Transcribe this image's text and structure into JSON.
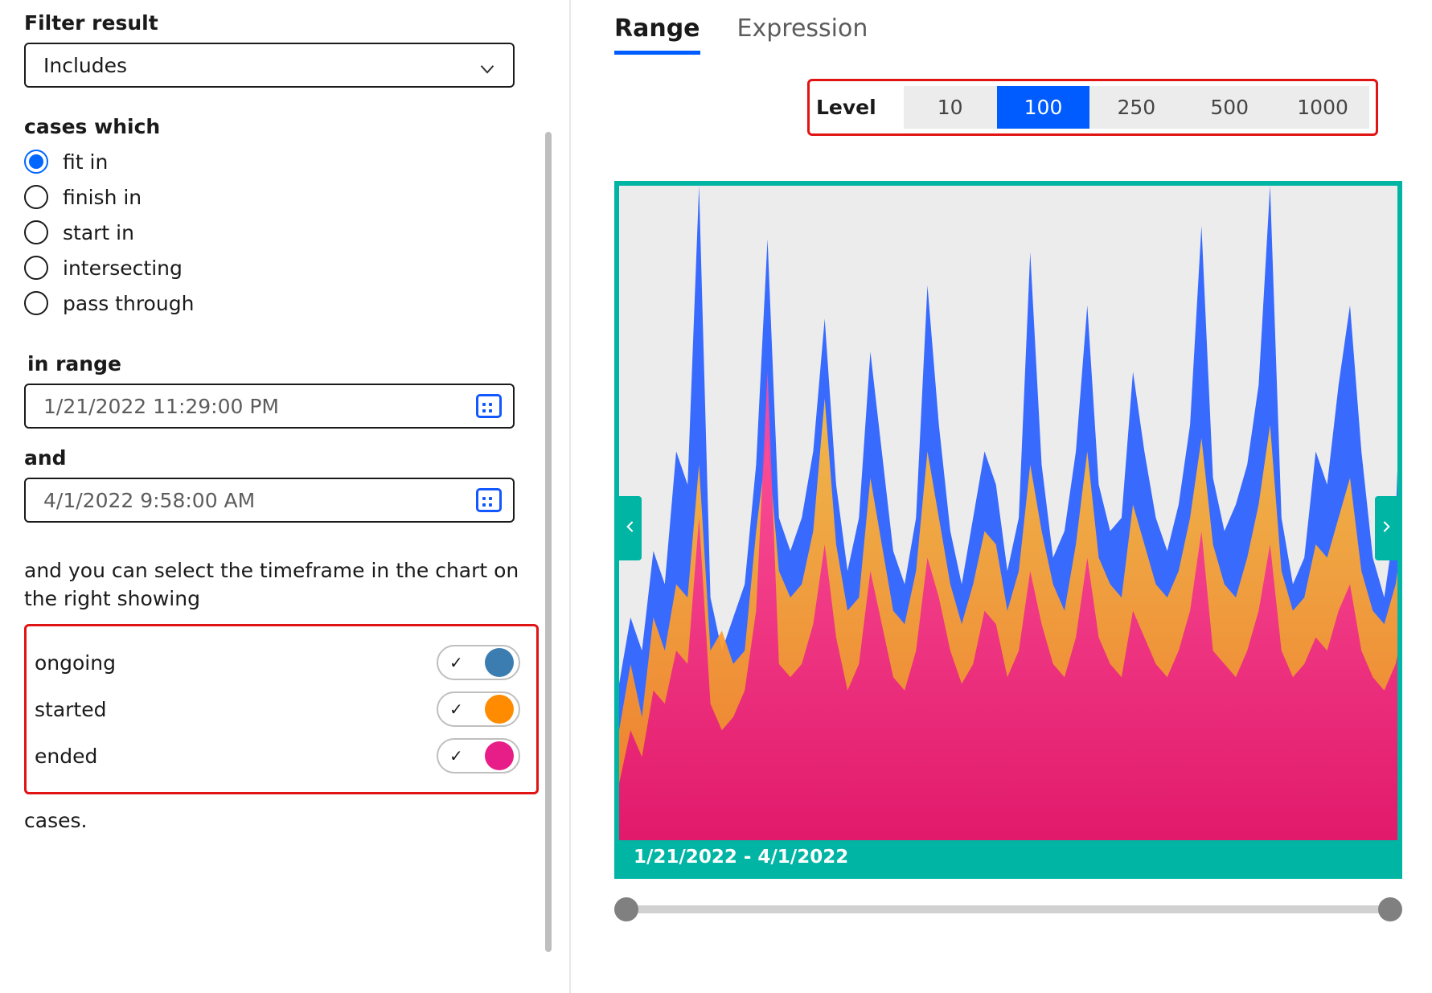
{
  "filter": {
    "title": "Filter result",
    "select_value": "Includes",
    "cases_which": "cases which",
    "options": [
      "fit in",
      "finish in",
      "start in",
      "intersecting",
      "pass through"
    ],
    "selected_index": 0,
    "in_range_label": "in range",
    "range_from": "1/21/2022 11:29:00 PM",
    "and_label": "and",
    "range_to": "4/1/2022 9:58:00 AM",
    "helper": "and you can select the timeframe in the chart on the right showing",
    "toggles": [
      {
        "label": "ongoing",
        "color": "blue",
        "on": true
      },
      {
        "label": "started",
        "color": "orange",
        "on": true
      },
      {
        "label": "ended",
        "color": "pink",
        "on": true
      }
    ],
    "cases_word": "cases."
  },
  "right": {
    "tabs": {
      "range": "Range",
      "expression": "Expression",
      "active": 0
    },
    "level_label": "Level",
    "levels": [
      "10",
      "100",
      "250",
      "500",
      "1000"
    ],
    "level_active": 1,
    "range_text": "1/21/2022 - 4/1/2022"
  },
  "chart_data": {
    "type": "area",
    "title": "",
    "x_range": [
      "1/21/2022",
      "4/1/2022"
    ],
    "ylim": [
      0,
      100
    ],
    "n_points": 70,
    "series": [
      {
        "name": "ongoing",
        "color": "#2e63ff",
        "values": [
          25,
          35,
          30,
          45,
          40,
          60,
          55,
          100,
          38,
          30,
          35,
          40,
          58,
          92,
          50,
          45,
          50,
          60,
          80,
          55,
          42,
          50,
          75,
          60,
          45,
          40,
          50,
          85,
          64,
          48,
          40,
          50,
          60,
          55,
          42,
          50,
          90,
          58,
          44,
          48,
          60,
          82,
          55,
          48,
          50,
          72,
          60,
          50,
          45,
          52,
          64,
          94,
          56,
          48,
          52,
          58,
          70,
          100,
          50,
          40,
          44,
          60,
          55,
          70,
          82,
          60,
          44,
          38,
          50,
          96
        ]
      },
      {
        "name": "started",
        "color": "#ff8c00",
        "values": [
          18,
          28,
          20,
          35,
          30,
          40,
          38,
          58,
          30,
          33,
          28,
          30,
          48,
          62,
          42,
          38,
          40,
          48,
          68,
          46,
          36,
          38,
          56,
          46,
          36,
          34,
          42,
          60,
          50,
          40,
          34,
          40,
          48,
          46,
          36,
          42,
          58,
          48,
          40,
          36,
          46,
          60,
          44,
          40,
          38,
          52,
          46,
          40,
          38,
          42,
          50,
          62,
          46,
          40,
          38,
          44,
          52,
          64,
          42,
          36,
          38,
          46,
          44,
          50,
          56,
          42,
          36,
          34,
          40,
          52
        ]
      },
      {
        "name": "ended",
        "color": "#e81e88",
        "values": [
          10,
          18,
          14,
          24,
          22,
          30,
          28,
          50,
          22,
          18,
          20,
          24,
          36,
          72,
          28,
          26,
          28,
          34,
          46,
          32,
          24,
          28,
          42,
          34,
          26,
          24,
          30,
          44,
          38,
          30,
          25,
          28,
          36,
          34,
          26,
          30,
          42,
          34,
          28,
          26,
          32,
          44,
          32,
          28,
          26,
          36,
          32,
          28,
          26,
          30,
          36,
          48,
          30,
          28,
          26,
          30,
          36,
          46,
          30,
          26,
          28,
          32,
          30,
          36,
          40,
          30,
          26,
          24,
          28,
          36
        ]
      }
    ]
  }
}
